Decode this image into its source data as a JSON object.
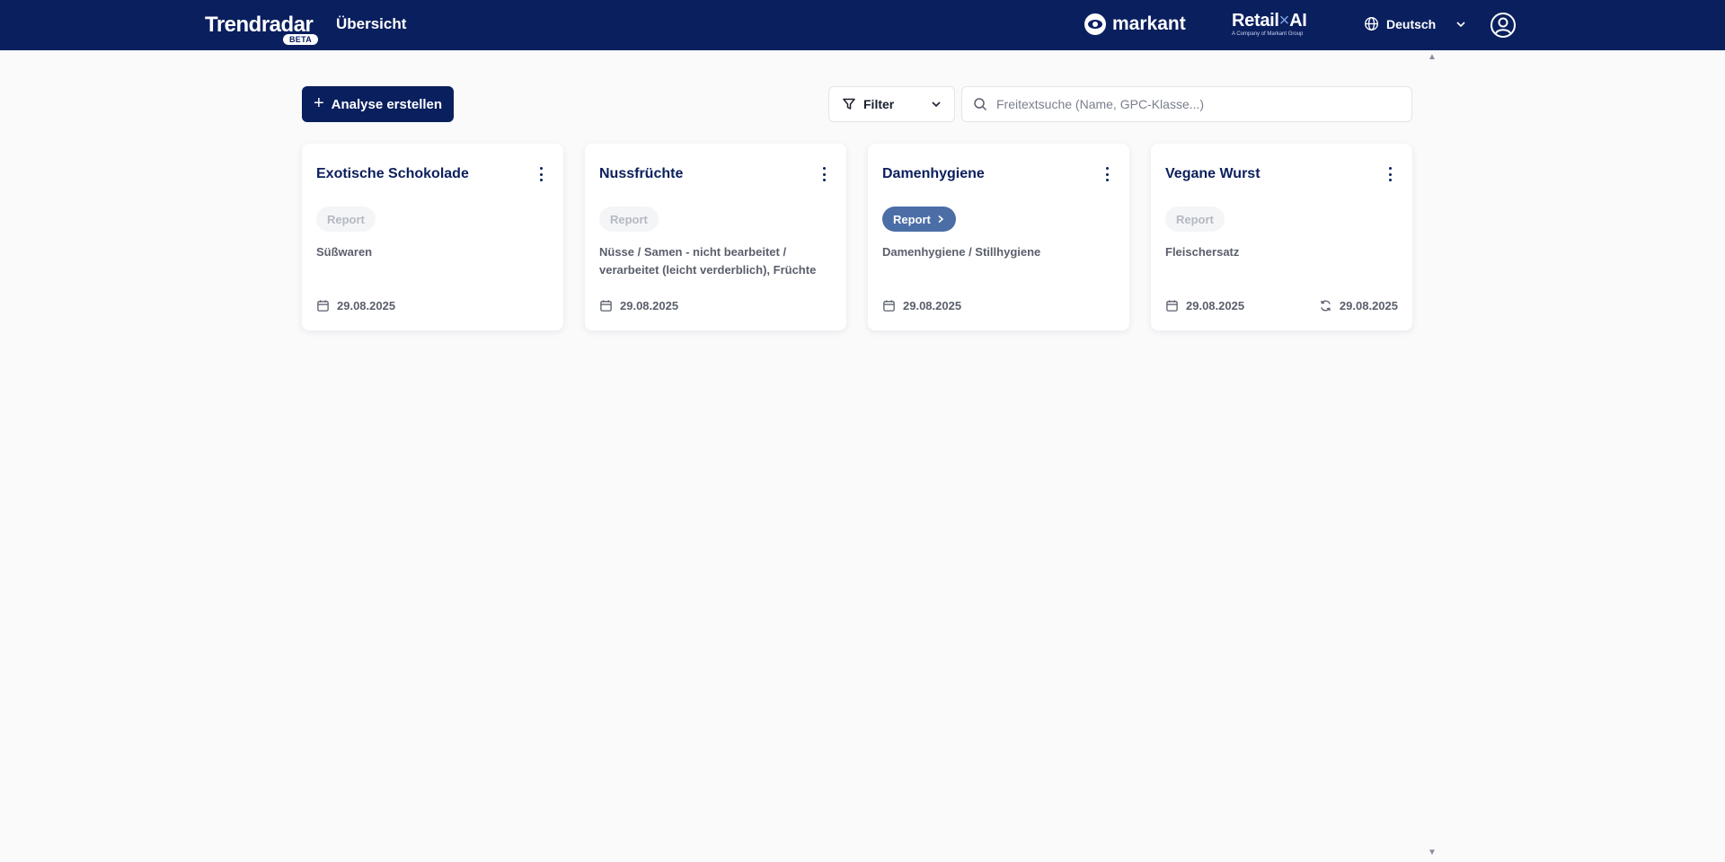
{
  "header": {
    "brand": "Trendradar",
    "badge": "BETA",
    "nav_title": "Übersicht",
    "partner_logo": "markant",
    "retail_logo_main": "Retail",
    "retail_logo_x": "×",
    "retail_logo_ai": "AI",
    "retail_logo_sub": "A Company of Markant Group",
    "language": "Deutsch",
    "icons": [
      "globe-icon",
      "chevron-down-icon",
      "account-icon"
    ]
  },
  "toolbar": {
    "create_label": "Analyse erstellen",
    "filter_label": "Filter",
    "search_placeholder": "Freitextsuche (Name, GPC-Klasse...)"
  },
  "cards": [
    {
      "title": "Exotische Schokolade",
      "pill": "Report",
      "pill_state": "inactive",
      "category": "Süßwaren",
      "date": "29.08.2025",
      "updated": ""
    },
    {
      "title": "Nussfrüchte",
      "pill": "Report",
      "pill_state": "inactive",
      "category": "Nüsse / Samen - nicht bearbeitet / verarbeitet (leicht verderblich), Früchte",
      "date": "29.08.2025",
      "updated": ""
    },
    {
      "title": "Damenhygiene",
      "pill": "Report",
      "pill_state": "active",
      "category": "Damenhygiene / Stillhygiene",
      "date": "29.08.2025",
      "updated": ""
    },
    {
      "title": "Vegane Wurst",
      "pill": "Report",
      "pill_state": "inactive",
      "category": "Fleischersatz",
      "date": "29.08.2025",
      "updated": "29.08.2025"
    }
  ],
  "colors": {
    "header_bg": "#0a1f5e",
    "accent_pill": "#4b6ea6",
    "page_bg": "#fafafb"
  }
}
